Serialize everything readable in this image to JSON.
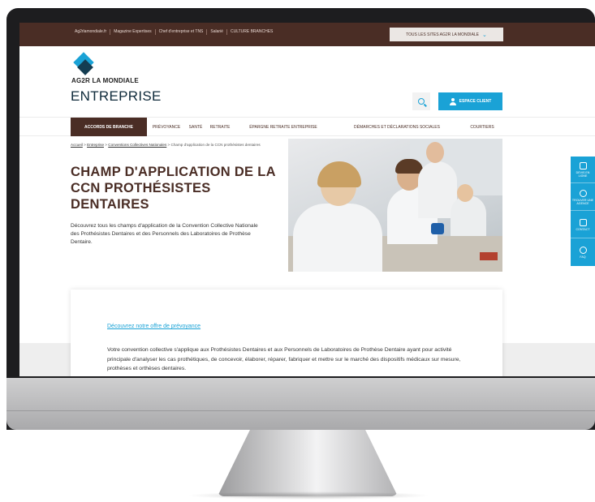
{
  "topbar": {
    "links": [
      "Ag2rlamondiale.fr",
      "Magazine Expertises",
      "Chef d'entreprise et TNS",
      "Salarié",
      "CULTURE BRANCHES"
    ],
    "sites_label": "TOUS LES SITES AG2R LA MONDIALE"
  },
  "brand": {
    "name": "AG2R LA MONDIALE",
    "sub": "ENTREPRISE"
  },
  "header": {
    "client_label": "ESPACE CLIENT"
  },
  "nav": {
    "items": [
      "ACCORDS DE BRANCHE",
      "PRÉVOYANCE",
      "SANTÉ",
      "RETRAITE",
      "ÉPARGNE RETRAITE ENTREPRISE",
      "DÉMARCHES ET DÉCLARATIONS SOCIALES",
      "COURTIERS"
    ]
  },
  "breadcrumb": {
    "items": [
      "Accueil",
      "Entreprise",
      "Conventions Collectives Nationales"
    ],
    "current": "Champ d'application de la CCN prothésistes dentaires",
    "separator": ">"
  },
  "page": {
    "title": "CHAMP D'APPLICATION DE LA CCN PROTHÉSISTES DENTAIRES",
    "intro": "Découvrez tous les champs d'application de la Convention Collective Nationale des Prothésistes Dentaires et des Personnels des Laboratoires de Prothèse Dentaire."
  },
  "content": {
    "offer_link": "Découvrez notre offre de prévoyance",
    "body": "Votre convention collective s'applique aux Prothésistes Dentaires et aux Personnels de Laboratoires de Prothèse Dentaire ayant pour activité principale d'analyser les cas prothétiques, de concevoir, élaborer, réparer, fabriquer et mettre sur le marché des dispositifs médicaux sur mesure, prothèses et orthèses dentaires."
  },
  "side_tools": [
    {
      "label": "DEVIS EN LIGNE",
      "icon": "document-icon"
    },
    {
      "label": "TROUVER UNE AGENCE",
      "icon": "location-pin-icon"
    },
    {
      "label": "CONTACT",
      "icon": "chat-icon"
    },
    {
      "label": "FAQ",
      "icon": "info-icon"
    }
  ],
  "colors": {
    "brown": "#4a2d25",
    "accent_blue": "#1aa2d6"
  }
}
